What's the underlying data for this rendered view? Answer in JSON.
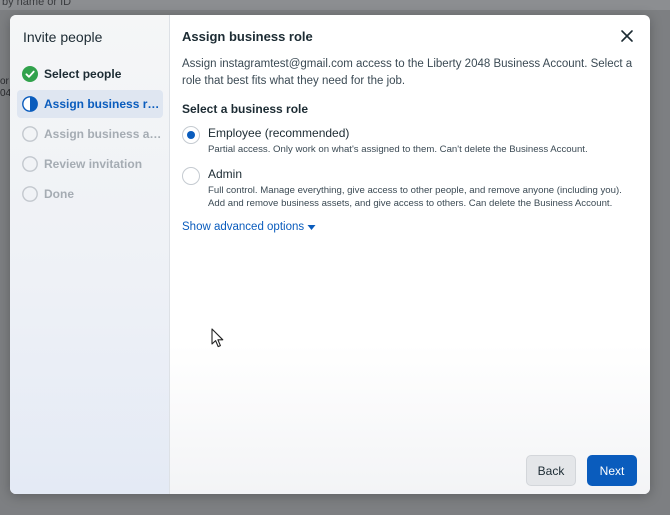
{
  "background": {
    "hint_text": "by name or ID",
    "clip_lines": [
      "or",
      "04"
    ]
  },
  "sidebar": {
    "title": "Invite people",
    "steps": [
      {
        "label": "Select people",
        "state": "done"
      },
      {
        "label": "Assign business role",
        "state": "active"
      },
      {
        "label": "Assign business ass...",
        "state": "future"
      },
      {
        "label": "Review invitation",
        "state": "future"
      },
      {
        "label": "Done",
        "state": "future"
      }
    ]
  },
  "main": {
    "title": "Assign business role",
    "description": "Assign instagramtest@gmail.com access to the Liberty 2048 Business Account. Select a role that best fits what they need for the job.",
    "section_label": "Select a business role",
    "roles": [
      {
        "title": "Employee (recommended)",
        "description": "Partial access. Only work on what's assigned to them. Can't delete the Business Account.",
        "selected": true
      },
      {
        "title": "Admin",
        "description": "Full control. Manage everything, give access to other people, and remove anyone (including you). Add and remove business assets, and give access to others. Can delete the Business Account.",
        "selected": false
      }
    ],
    "advanced_link": "Show advanced options"
  },
  "footer": {
    "back_label": "Back",
    "next_label": "Next"
  },
  "colors": {
    "accent": "#0a5cbd",
    "success": "#31a24c",
    "muted": "#a5acb3",
    "overlay": "#7d7f82"
  },
  "icons": {
    "close": "close-icon",
    "done_step": "check-circle-icon",
    "active_step": "half-circle-icon",
    "future_step": "empty-circle-icon",
    "advanced_toggle": "caret-down-icon",
    "cursor": "mouse-pointer-icon"
  }
}
